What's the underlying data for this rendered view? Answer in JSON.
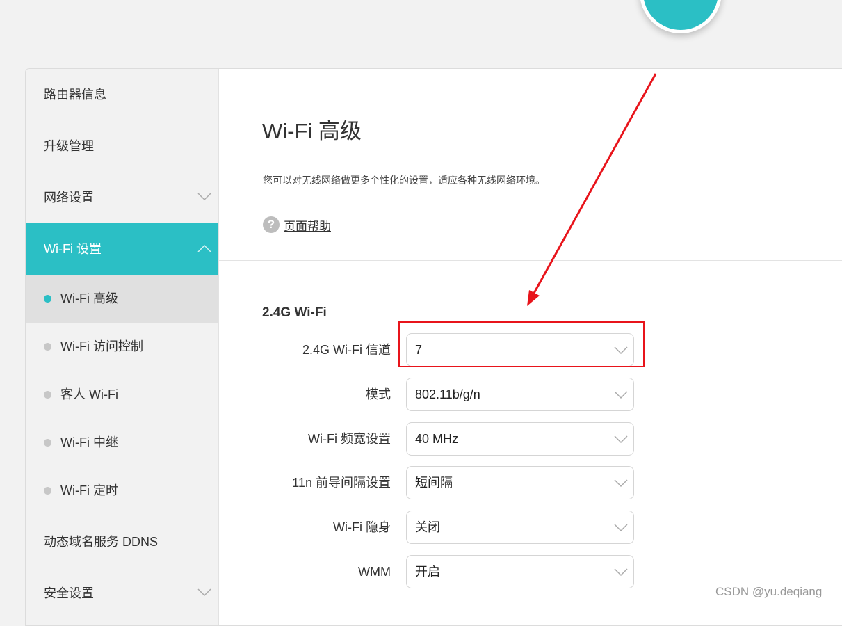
{
  "sidebar": {
    "items": [
      {
        "label": "路由器信息"
      },
      {
        "label": "升级管理"
      },
      {
        "label": "网络设置"
      },
      {
        "label": "Wi-Fi 设置"
      }
    ],
    "sub_items": [
      {
        "label": "Wi-Fi 高级"
      },
      {
        "label": "Wi-Fi 访问控制"
      },
      {
        "label": "客人 Wi-Fi"
      },
      {
        "label": "Wi-Fi 中继"
      },
      {
        "label": "Wi-Fi 定时"
      }
    ],
    "bottom_items": [
      {
        "label": "动态域名服务 DDNS"
      },
      {
        "label": "安全设置"
      }
    ]
  },
  "main": {
    "title": "Wi-Fi 高级",
    "description": "您可以对无线网络做更多个性化的设置，适应各种无线网络环境。",
    "help_icon_glyph": "?",
    "help_link": "页面帮助",
    "section_title": "2.4G Wi-Fi",
    "fields": [
      {
        "label": "2.4G Wi-Fi 信道",
        "value": "7"
      },
      {
        "label": "模式",
        "value": "802.11b/g/n"
      },
      {
        "label": "Wi-Fi 频宽设置",
        "value": "40 MHz"
      },
      {
        "label": "11n 前导间隔设置",
        "value": "短间隔"
      },
      {
        "label": "Wi-Fi 隐身",
        "value": "关闭"
      },
      {
        "label": "WMM",
        "value": "开启"
      }
    ]
  },
  "colors": {
    "accent": "#2bbfc5",
    "annotation_red": "#e8141b",
    "sidebar_bg": "#f2f2f2",
    "selected_bg": "#e0e0e0"
  },
  "icons": {
    "fab": "menu-icon",
    "expand": "chevron-down-icon",
    "collapse": "chevron-up-icon",
    "help": "question-icon"
  },
  "watermark": "CSDN @yu.deqiang"
}
